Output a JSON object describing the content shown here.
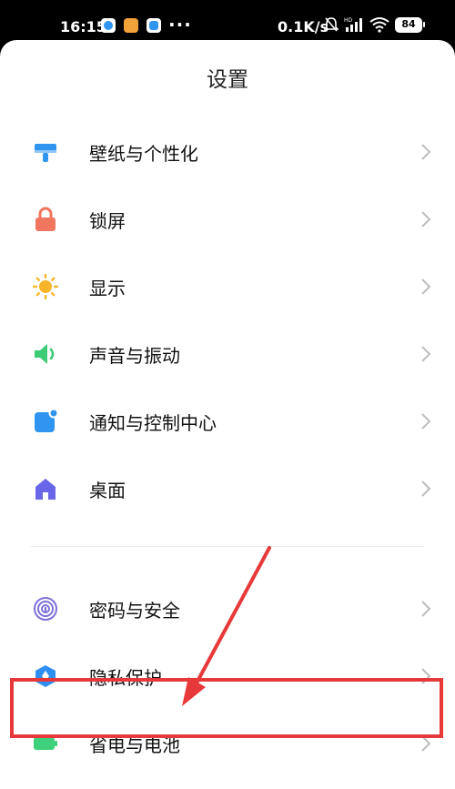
{
  "status_bar": {
    "time": "16:15",
    "dots": "···",
    "speed": "0.1K/s",
    "signal_label": "HD",
    "battery": "84"
  },
  "header": {
    "title": "设置"
  },
  "settings_group1": [
    {
      "label": "壁纸与个性化",
      "icon": "wallpaper-brush-icon"
    },
    {
      "label": "锁屏",
      "icon": "lock-icon"
    },
    {
      "label": "显示",
      "icon": "sun-icon"
    },
    {
      "label": "声音与振动",
      "icon": "speaker-icon"
    },
    {
      "label": "通知与控制中心",
      "icon": "notification-icon"
    },
    {
      "label": "桌面",
      "icon": "home-icon"
    }
  ],
  "settings_group2": [
    {
      "label": "密码与安全",
      "icon": "fingerprint-icon"
    },
    {
      "label": "隐私保护",
      "icon": "privacy-shield-icon"
    },
    {
      "label": "省电与电池",
      "icon": "battery-icon"
    }
  ],
  "colors": {
    "highlight": "#e8393a",
    "wallpaper": "#2f95f0",
    "lock": "#f0765f",
    "display": "#f7b52a",
    "sound": "#3ecb77",
    "notification": "#2f95f0",
    "home": "#6a66e8",
    "security": "#7c6fd9",
    "privacy": "#2f8ff0",
    "battery": "#3ed07a"
  }
}
